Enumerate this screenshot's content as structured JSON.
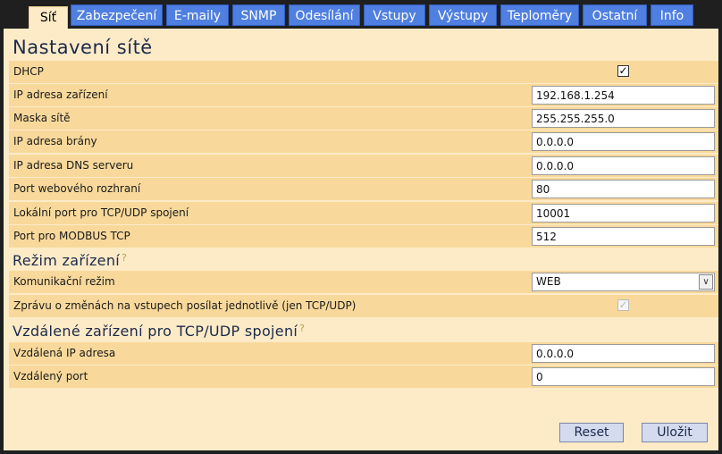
{
  "tabs": [
    "Síť",
    "Zabezpečení",
    "E-maily",
    "SNMP",
    "Odesílání",
    "Vstupy",
    "Výstupy",
    "Teploměry",
    "Ostatní",
    "Info"
  ],
  "network": {
    "title": "Nastavení sítě",
    "dhcp_label": "DHCP",
    "dhcp_checked": true,
    "ip_label": "IP adresa zařízení",
    "ip_value": "192.168.1.254",
    "mask_label": "Maska sítě",
    "mask_value": "255.255.255.0",
    "gateway_label": "IP adresa brány",
    "gateway_value": "0.0.0.0",
    "dns_label": "IP adresa DNS serveru",
    "dns_value": "0.0.0.0",
    "web_port_label": "Port webového rozhraní",
    "web_port_value": "80",
    "local_port_label": "Lokální port pro TCP/UDP spojení",
    "local_port_value": "10001",
    "modbus_label": "Port pro MODBUS TCP",
    "modbus_value": "512"
  },
  "mode": {
    "title": "Režim zařízení",
    "help": "?",
    "comm_label": "Komunikační režim",
    "comm_value": "WEB",
    "notify_label": "Zprávu o změnách na vstupech posílat jednotlivě (jen TCP/UDP)",
    "notify_checked": true
  },
  "remote": {
    "title": "Vzdálené zařízení pro TCP/UDP spojení",
    "help": "?",
    "ip_label": "Vzdálená IP adresa",
    "ip_value": "0.0.0.0",
    "port_label": "Vzdálený port",
    "port_value": "0"
  },
  "buttons": {
    "reset": "Reset",
    "save": "Uložit"
  }
}
